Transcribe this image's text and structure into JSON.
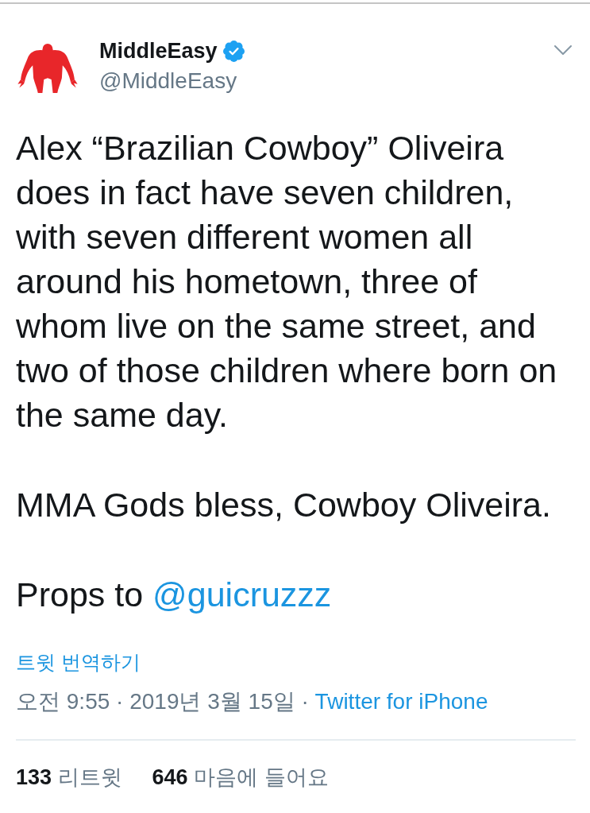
{
  "account": {
    "name": "MiddleEasy",
    "verified": true,
    "handle": "@MiddleEasy"
  },
  "tweet": {
    "paragraphs": [
      {
        "segments": [
          {
            "kind": "text",
            "text": "Alex “Brazilian Cowboy” Oliveira does in fact have seven children, with seven different women all around his hometown, three of whom live on the same street, and two of those children where born on the same day."
          }
        ]
      },
      {
        "segments": [
          {
            "kind": "text",
            "text": "MMA Gods bless, Cowboy Oliveira."
          }
        ]
      },
      {
        "segments": [
          {
            "kind": "text",
            "text": "Props to "
          },
          {
            "kind": "mention",
            "text": "@guicruzzz"
          }
        ]
      }
    ]
  },
  "translate_link": "트윗 번역하기",
  "meta": {
    "timestamp": "오전 9:55 · 2019년 3월 15일 · ",
    "source": "Twitter for iPhone"
  },
  "stats": [
    {
      "count": "133",
      "label": "리트윗"
    },
    {
      "count": "646",
      "label": "마음에 들어요"
    }
  ]
}
